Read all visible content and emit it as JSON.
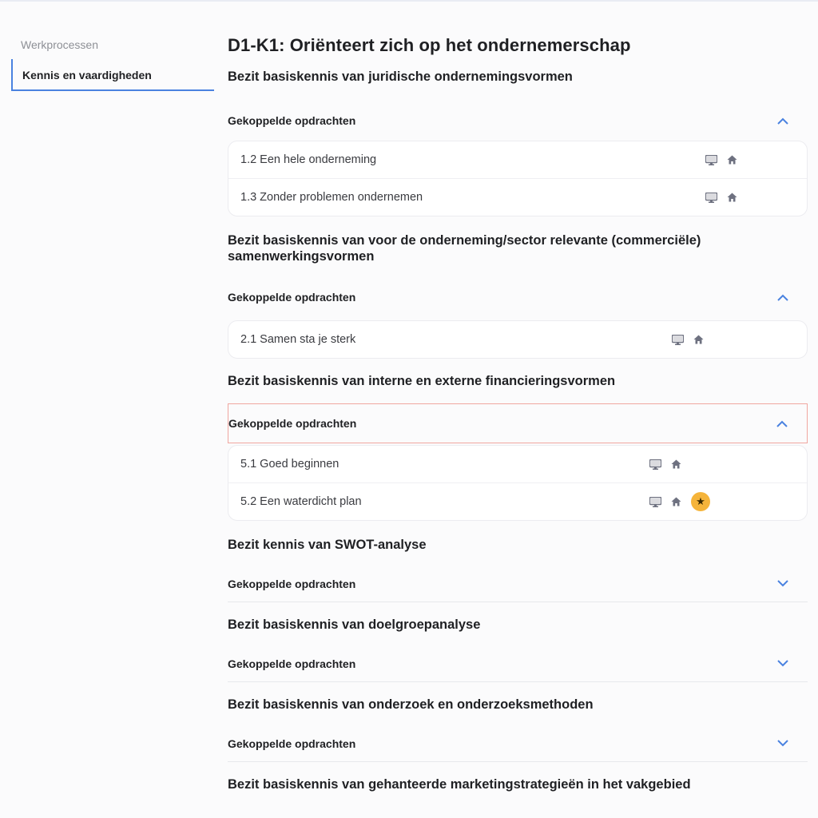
{
  "sidebar": {
    "items": [
      {
        "label": "Werkprocessen",
        "active": false
      },
      {
        "label": "Kennis en vaardigheden",
        "active": true
      }
    ]
  },
  "main": {
    "title": "D1-K1: Oriënteert zich op het ondernemerschap",
    "sections": [
      {
        "title": "Bezit basiskennis van juridische ondernemingsvormen",
        "linked_label": "Gekoppelde opdrachten",
        "expanded": true,
        "tasks": [
          {
            "label": "1.2 Een hele onderneming",
            "icons": [
              "computer-icon",
              "home-icon"
            ]
          },
          {
            "label": "1.3 Zonder problemen ondernemen",
            "icons": [
              "computer-icon",
              "home-icon"
            ]
          }
        ]
      },
      {
        "title": "Bezit basiskennis van voor de onderneming/sector relevante (commerciële) samenwerkingsvormen",
        "linked_label": "Gekoppelde opdrachten",
        "expanded": true,
        "tasks": [
          {
            "label": "2.1 Samen sta je sterk",
            "icons": [
              "computer-icon",
              "home-icon"
            ]
          }
        ]
      },
      {
        "title": "Bezit basiskennis van interne en externe financieringsvormen",
        "linked_label": "Gekoppelde opdrachten",
        "expanded": true,
        "tasks": [
          {
            "label": "5.1 Goed beginnen",
            "icons": [
              "computer-icon",
              "home-icon"
            ]
          },
          {
            "label": "5.2 Een waterdicht plan",
            "icons": [
              "computer-icon",
              "home-icon",
              "star-icon"
            ]
          }
        ]
      },
      {
        "title": "Bezit kennis van SWOT-analyse",
        "linked_label": "Gekoppelde opdrachten",
        "expanded": false
      },
      {
        "title": "Bezit basiskennis van doelgroepanalyse",
        "linked_label": "Gekoppelde opdrachten",
        "expanded": false
      },
      {
        "title": "Bezit basiskennis van onderzoek en onderzoeksmethoden",
        "linked_label": "Gekoppelde opdrachten",
        "expanded": false
      },
      {
        "title": "Bezit basiskennis van gehanteerde marketingstrategieën in het vakgebied"
      }
    ]
  },
  "colors": {
    "accent": "#4a82e0",
    "star_badge": "#f5b43a",
    "highlight_border": "#f0a6a0"
  }
}
